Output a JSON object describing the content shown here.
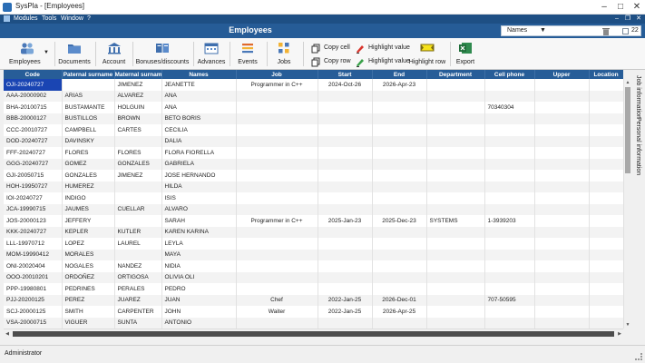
{
  "window": {
    "title": "SysPla - [Employees]",
    "controls": [
      "–",
      "□",
      "✕"
    ]
  },
  "menu": {
    "items": [
      "Modules",
      "Tools",
      "Window",
      "?"
    ],
    "child_controls": [
      "–",
      "❐",
      "✕"
    ]
  },
  "header": {
    "title": "Employees",
    "search_field": "Names",
    "search_value": "",
    "record_count": "22"
  },
  "toolbar": {
    "employees": "Employees",
    "documents": "Documents",
    "account": "Account",
    "bonuses": "Bonuses/discounts",
    "advances": "Advances",
    "events": "Events",
    "jobs": "Jobs",
    "copy_cell": "Copy cell",
    "copy_row": "Copy row",
    "highlight_value_1": "Highlight value",
    "highlight_value_2": "Highlight value",
    "highlight_row": "Highlight row",
    "export": "Export"
  },
  "grid": {
    "columns": [
      "Code",
      "Paternal surname",
      "Maternal surname",
      "Names",
      "Job",
      "Start",
      "End",
      "Department",
      "Cell phone",
      "Upper",
      "Location"
    ],
    "rows": [
      [
        "OJI-20240727",
        "",
        "JIMENEZ",
        "JEANETTE",
        "Programmer in C++",
        "2024-Oct-26",
        "2026-Apr-23",
        "",
        "",
        "",
        ""
      ],
      [
        "AAA-20000902",
        "ARIAS",
        "ALVAREZ",
        "ANA",
        "",
        "",
        "",
        "",
        "",
        "",
        ""
      ],
      [
        "BHA-20100715",
        "BUSTAMANTE",
        "HOLGUIN",
        "ANA",
        "",
        "",
        "",
        "",
        "70340304",
        "",
        ""
      ],
      [
        "BBB-20000127",
        "BUSTILLOS",
        "BROWN",
        "BETO BORIS",
        "",
        "",
        "",
        "",
        "",
        "",
        ""
      ],
      [
        "CCC-20010727",
        "CAMPBELL",
        "CARTES",
        "CECILIA",
        "",
        "",
        "",
        "",
        "",
        "",
        ""
      ],
      [
        "DOD-20240727",
        "DAVINSKY",
        "",
        "DALIA",
        "",
        "",
        "",
        "",
        "",
        "",
        ""
      ],
      [
        "FFF-20240727",
        "FLORES",
        "FLORES",
        "FLORA FIORELLA",
        "",
        "",
        "",
        "",
        "",
        "",
        ""
      ],
      [
        "GGG-20240727",
        "GOMEZ",
        "GONZALES",
        "GABRIELA",
        "",
        "",
        "",
        "",
        "",
        "",
        ""
      ],
      [
        "GJI-20050715",
        "GONZALES",
        "JIMENEZ",
        "JOSE HERNANDO",
        "",
        "",
        "",
        "",
        "",
        "",
        ""
      ],
      [
        "HOH-19950727",
        "HUMEREZ",
        "",
        "HILDA",
        "",
        "",
        "",
        "",
        "",
        "",
        ""
      ],
      [
        "IOI-20240727",
        "INDIGO",
        "",
        "ISIS",
        "",
        "",
        "",
        "",
        "",
        "",
        ""
      ],
      [
        "JCA-19990715",
        "JAUMES",
        "CUELLAR",
        "ALVARO",
        "",
        "",
        "",
        "",
        "",
        "",
        ""
      ],
      [
        "JOS-20000123",
        "JEFFERY",
        "",
        "SARAH",
        "Programmer in C++",
        "2025-Jan-23",
        "2025-Dec-23",
        "SYSTEMS",
        "1-3939203",
        "",
        ""
      ],
      [
        "KKK-20240727",
        "KEPLER",
        "KUTLER",
        "KAREN KARINA",
        "",
        "",
        "",
        "",
        "",
        "",
        ""
      ],
      [
        "LLL-19970712",
        "LOPEZ",
        "LAUREL",
        "LEYLA",
        "",
        "",
        "",
        "",
        "",
        "",
        ""
      ],
      [
        "MOM-19990412",
        "MORALES",
        "",
        "MAYA",
        "",
        "",
        "",
        "",
        "",
        "",
        ""
      ],
      [
        "ONI-20020404",
        "NOGALES",
        "NANDEZ",
        "NIDIA",
        "",
        "",
        "",
        "",
        "",
        "",
        ""
      ],
      [
        "OOO-20010201",
        "ORDOÑEZ",
        "ORTIGOSA",
        "OLIVIA OLI",
        "",
        "",
        "",
        "",
        "",
        "",
        ""
      ],
      [
        "PPP-19980801",
        "PEDRINES",
        "PERALES",
        "PEDRO",
        "",
        "",
        "",
        "",
        "",
        "",
        ""
      ],
      [
        "PJJ-20200125",
        "PEREZ",
        "JUAREZ",
        "JUAN",
        "Chef",
        "2022-Jan-25",
        "2026-Dec-01",
        "",
        "707-50595",
        "",
        ""
      ],
      [
        "SCJ-20000125",
        "SMITH",
        "CARPENTER",
        "JOHN",
        "Waiter",
        "2022-Jan-25",
        "2026-Apr-25",
        "",
        "",
        "",
        ""
      ],
      [
        "VSA-20000715",
        "VIGUER",
        "SUNTA",
        "ANTONIO",
        "",
        "",
        "",
        "",
        "",
        "",
        ""
      ]
    ]
  },
  "side_tabs": [
    "Job information",
    "Personal information"
  ],
  "status": {
    "user": "Administrator"
  },
  "colors": {
    "menu_bar": "#1e4f84",
    "header_band": "#265c97",
    "selected_cell": "#1a45b3"
  }
}
